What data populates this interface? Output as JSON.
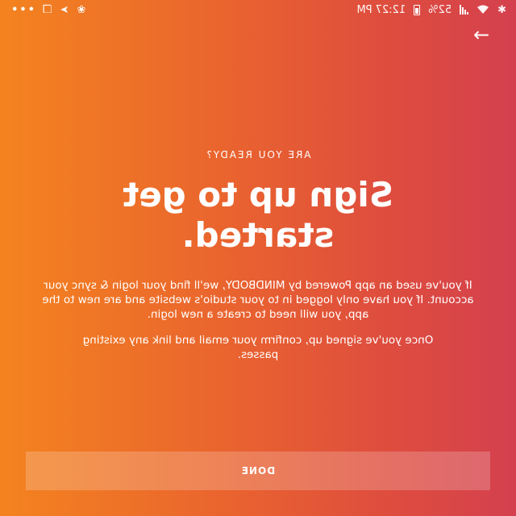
{
  "status_bar": {
    "time": "12:27 PM",
    "battery": "52%",
    "more": "•••"
  },
  "nav": {
    "arrow_glyph": "→"
  },
  "content": {
    "eyebrow": "ARE YOU READY?",
    "headline": "Sign up to get started.",
    "paragraph1": "If you've used an app Powered by MINDBODY, we'll find your login & sync your account. If you have only logged in to your studio's website and are new to the app, you will need to create a new login.",
    "paragraph2": "Once you've signed up, confirm your email and link any existing passes."
  },
  "done_button": {
    "label": "DONE"
  },
  "colors": {
    "gradient_start": "#f4831f",
    "gradient_end": "#d4404e",
    "text": "#ffffff"
  }
}
